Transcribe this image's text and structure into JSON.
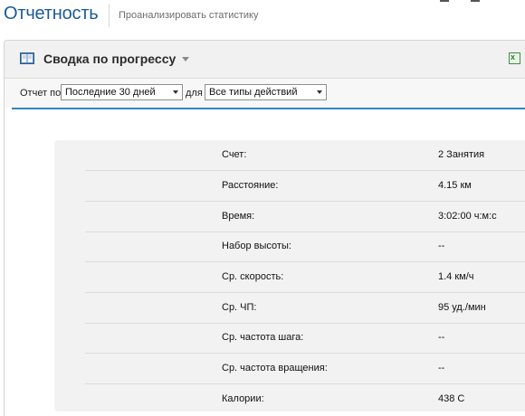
{
  "header": {
    "title": "Отчетность",
    "subtitle": "Проанализировать статистику"
  },
  "panel": {
    "title": "Сводка по прогрессу",
    "icon": "book-icon",
    "export_icon": "excel-export-icon"
  },
  "filter": {
    "report_label": "Отчет по",
    "period_value": "Последние 30 дней",
    "for_label": "для",
    "activity_value": "Все типы действий"
  },
  "stats": [
    {
      "label": "Счет:",
      "value": "2 Занятия"
    },
    {
      "label": "Расстояние:",
      "value": "4.15 км"
    },
    {
      "label": "Время:",
      "value": "3:02:00 ч:м:с"
    },
    {
      "label": "Набор высоты:",
      "value": "--"
    },
    {
      "label": "Ср. скорость:",
      "value": "1.4 км/ч"
    },
    {
      "label": "Ср. ЧП:",
      "value": "95 уд./мин"
    },
    {
      "label": "Ср. частота шага:",
      "value": "--"
    },
    {
      "label": "Ср. частота вращения:",
      "value": "--"
    },
    {
      "label": "Калории:",
      "value": "438 С"
    }
  ],
  "colors": {
    "title": "#1a5b96",
    "accent": "#2f86c6"
  }
}
